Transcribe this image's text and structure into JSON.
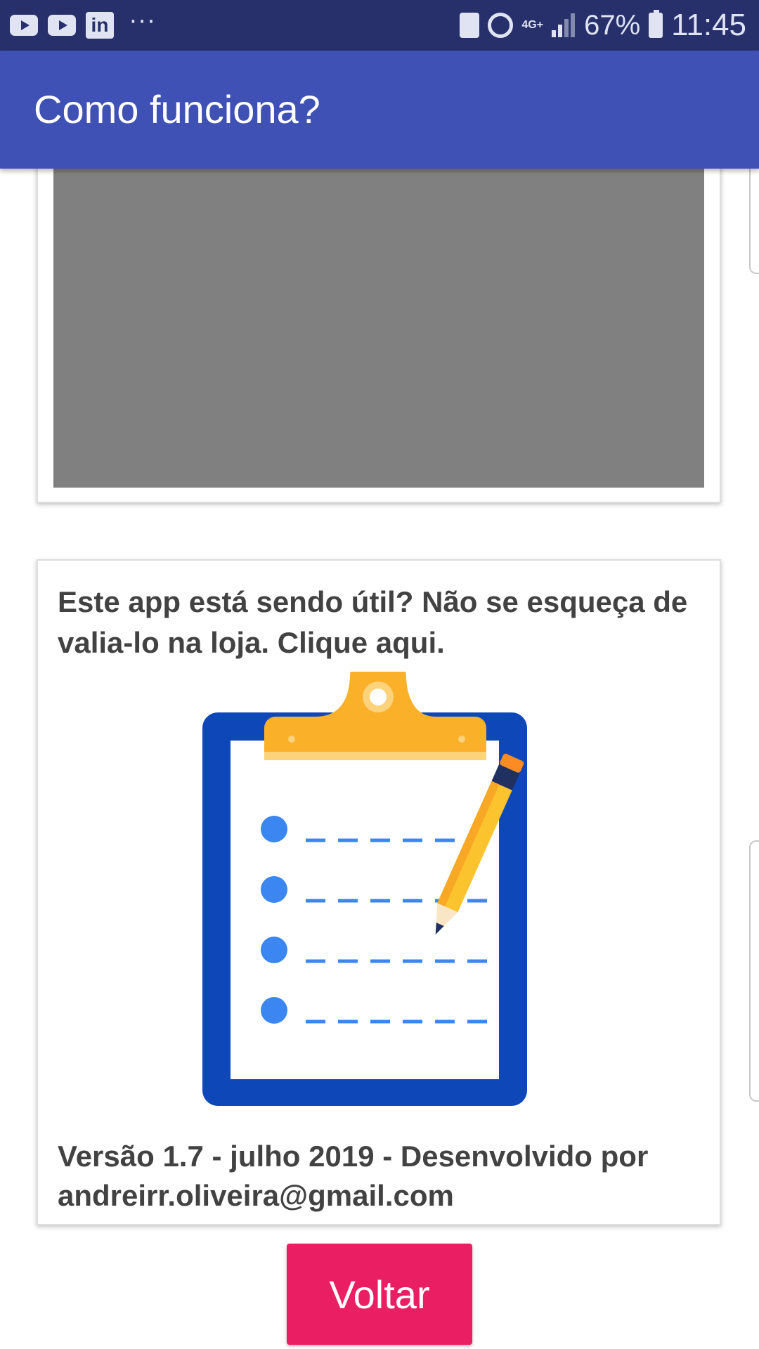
{
  "status_bar": {
    "battery_percent": "67%",
    "time": "11:45",
    "network": "4G+"
  },
  "app_bar": {
    "title": "Como funciona?"
  },
  "rate_card": {
    "text": "Este app está sendo útil? Não se esqueça de valia-lo na loja. Clique aqui."
  },
  "version_card": {
    "text": "Versão 1.7 - julho 2019 -  Desenvolvido por andreirr.oliveira@gmail.com"
  },
  "actions": {
    "back_label": "Voltar"
  },
  "colors": {
    "status_bar": "#27306b",
    "app_bar": "#3f51b5",
    "accent": "#e91e63",
    "clipboard_frame": "#0d47b8",
    "clip": "#fbb02a",
    "bullet": "#3b86f0"
  }
}
